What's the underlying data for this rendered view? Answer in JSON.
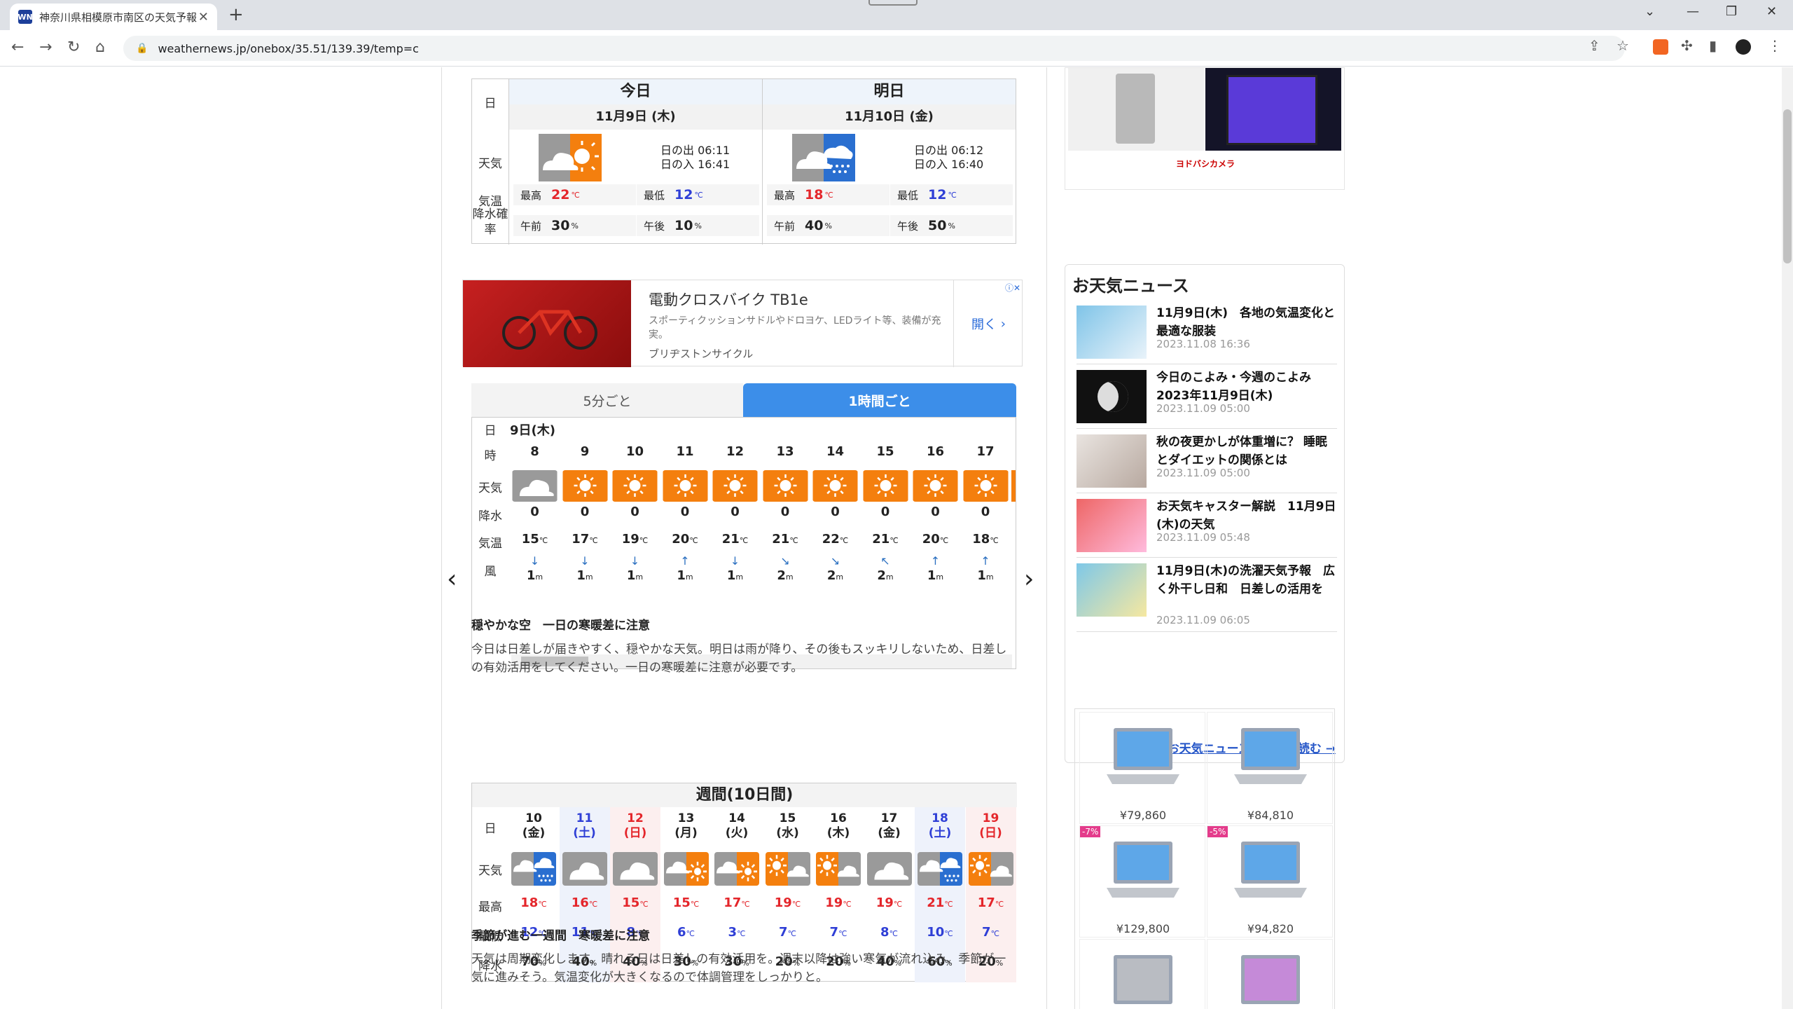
{
  "browser": {
    "tab_title": "神奈川県相模原市南区の天気予報",
    "favicon_text": "WN",
    "url": "weathernews.jp/onebox/35.51/139.39/temp=c"
  },
  "today_tomorrow": {
    "label_day": "日",
    "label_weather": "天気",
    "label_temp": "気温",
    "label_rain": "降水確率",
    "days": [
      {
        "name": "今日",
        "date": "11月9日 (木)",
        "sunrise": "日の出 06:11",
        "sunset": "日の入 16:41",
        "max_label": "最高",
        "max": "22",
        "min_label": "最低",
        "min": "12",
        "am_label": "午前",
        "am": "30",
        "pm_label": "午後",
        "pm": "10",
        "icon": "cloud-sun-icon"
      },
      {
        "name": "明日",
        "date": "11月10日 (金)",
        "sunrise": "日の出 06:12",
        "sunset": "日の入 16:40",
        "max_label": "最高",
        "max": "18",
        "min_label": "最低",
        "min": "12",
        "am_label": "午前",
        "am": "40",
        "pm_label": "午後",
        "pm": "50",
        "icon": "cloud-rain-icon"
      }
    ],
    "unit_c": "℃",
    "unit_pct": "%"
  },
  "ad": {
    "title": "電動クロスバイク TB1e",
    "desc": "スポーティクッションサドルやドロヨケ、LEDライト等、装備が充実。",
    "brand": "ブリヂストンサイクル",
    "open": "開く"
  },
  "hourly": {
    "tab_5min": "5分ごと",
    "tab_1h": "1時間ごと",
    "label_day": "日",
    "label_hour": "時",
    "label_weather": "天気",
    "label_rain": "降水",
    "label_temp": "気温",
    "label_wind": "風",
    "date": "9日(木)",
    "hours": [
      {
        "h": "8",
        "rain": "0",
        "temp": "15",
        "wind": "1",
        "icon": "cloud-icon"
      },
      {
        "h": "9",
        "rain": "0",
        "temp": "17",
        "wind": "1",
        "icon": "sun-icon"
      },
      {
        "h": "10",
        "rain": "0",
        "temp": "19",
        "wind": "1",
        "icon": "sun-icon"
      },
      {
        "h": "11",
        "rain": "0",
        "temp": "20",
        "wind": "1",
        "icon": "sun-icon"
      },
      {
        "h": "12",
        "rain": "0",
        "temp": "21",
        "wind": "1",
        "icon": "sun-icon"
      },
      {
        "h": "13",
        "rain": "0",
        "temp": "21",
        "wind": "2",
        "icon": "sun-icon"
      },
      {
        "h": "14",
        "rain": "0",
        "temp": "22",
        "wind": "2",
        "icon": "sun-icon"
      },
      {
        "h": "15",
        "rain": "0",
        "temp": "21",
        "wind": "2",
        "icon": "sun-icon"
      },
      {
        "h": "16",
        "rain": "0",
        "temp": "20",
        "wind": "1",
        "icon": "sun-icon"
      },
      {
        "h": "17",
        "rain": "0",
        "temp": "18",
        "wind": "1",
        "icon": "sun-icon"
      }
    ],
    "wind_unit": "m",
    "summary_title": "穏やかな空　一日の寒暖差に注意",
    "summary_text": "今日は日差しが届きやすく、穏やかな天気。明日は雨が降り、その後もスッキリしないため、日差しの有効活用をしてください。一日の寒暖差に注意が必要です。"
  },
  "weekly": {
    "title": "週間(10日間)",
    "label_day": "日",
    "label_weather": "天気",
    "label_max": "最高",
    "label_min": "最低",
    "label_rain": "降水",
    "days": [
      {
        "d": "10",
        "w": "(金)",
        "type": "",
        "hi": "18",
        "lo": "12",
        "pr": "70",
        "icon": "cloud-rain-icon"
      },
      {
        "d": "11",
        "w": "(土)",
        "type": "sat",
        "hi": "16",
        "lo": "11",
        "pr": "40",
        "icon": "cloud-icon"
      },
      {
        "d": "12",
        "w": "(日)",
        "type": "sun",
        "hi": "15",
        "lo": "8",
        "pr": "40",
        "icon": "cloud-icon"
      },
      {
        "d": "13",
        "w": "(月)",
        "type": "",
        "hi": "15",
        "lo": "6",
        "pr": "30",
        "icon": "cloud-sun-icon"
      },
      {
        "d": "14",
        "w": "(火)",
        "type": "",
        "hi": "17",
        "lo": "3",
        "pr": "30",
        "icon": "cloud-sun-icon"
      },
      {
        "d": "15",
        "w": "(水)",
        "type": "",
        "hi": "19",
        "lo": "7",
        "pr": "20",
        "icon": "sun-cloud-icon"
      },
      {
        "d": "16",
        "w": "(木)",
        "type": "",
        "hi": "19",
        "lo": "7",
        "pr": "20",
        "icon": "sun-cloud-icon"
      },
      {
        "d": "17",
        "w": "(金)",
        "type": "",
        "hi": "19",
        "lo": "8",
        "pr": "40",
        "icon": "cloud-icon"
      },
      {
        "d": "18",
        "w": "(土)",
        "type": "sat",
        "hi": "21",
        "lo": "10",
        "pr": "60",
        "icon": "cloud-rain-icon"
      },
      {
        "d": "19",
        "w": "(日)",
        "type": "sun",
        "hi": "17",
        "lo": "7",
        "pr": "20",
        "icon": "sun-cloud-icon"
      }
    ],
    "summary_title": "季節が進む一週間　寒暖差に注意",
    "summary_text": "天気は周期変化します。晴れる日は日差しの有効活用を。週末以降は強い寒気が流れ込み、季節が一気に進みそう。気温変化が大きくなるので体調管理をしっかりと。"
  },
  "news": {
    "title": "お天気ニュース",
    "items": [
      {
        "title": "11月9日(木)　各地の気温変化と最適な服装",
        "date": "2023.11.08 16:36"
      },
      {
        "title": "今日のこよみ・今週のこよみ 2023年11月9日(木)",
        "date": "2023.11.09 05:00"
      },
      {
        "title": "秋の夜更かしが体重増に？ 睡眠とダイエットの関係とは",
        "date": "2023.11.09 05:00"
      },
      {
        "title": "お天気キャスター解説　11月9日(木)の天気",
        "date": "2023.11.09 05:48"
      },
      {
        "title": "11月9日(木)の洗濯天気予報　広く外干し日和　日差しの活用を",
        "date": "2023.11.09 06:05"
      }
    ],
    "more": "お天気ニュースをもっと読む →"
  },
  "products": [
    {
      "price": "¥79,860",
      "badge": ""
    },
    {
      "price": "¥84,810",
      "badge": ""
    },
    {
      "price": "¥129,800",
      "badge": "-7%"
    },
    {
      "price": "¥94,820",
      "badge": "-5%"
    }
  ],
  "sidebar_ad": {
    "brand": "ヨドバシカメラ"
  },
  "colors": {
    "accent": "#3c8ee9",
    "sun": "#f47f0e",
    "cloud": "#9a9a9a",
    "hot": "#e4262b",
    "cold": "#2f3fd6"
  }
}
